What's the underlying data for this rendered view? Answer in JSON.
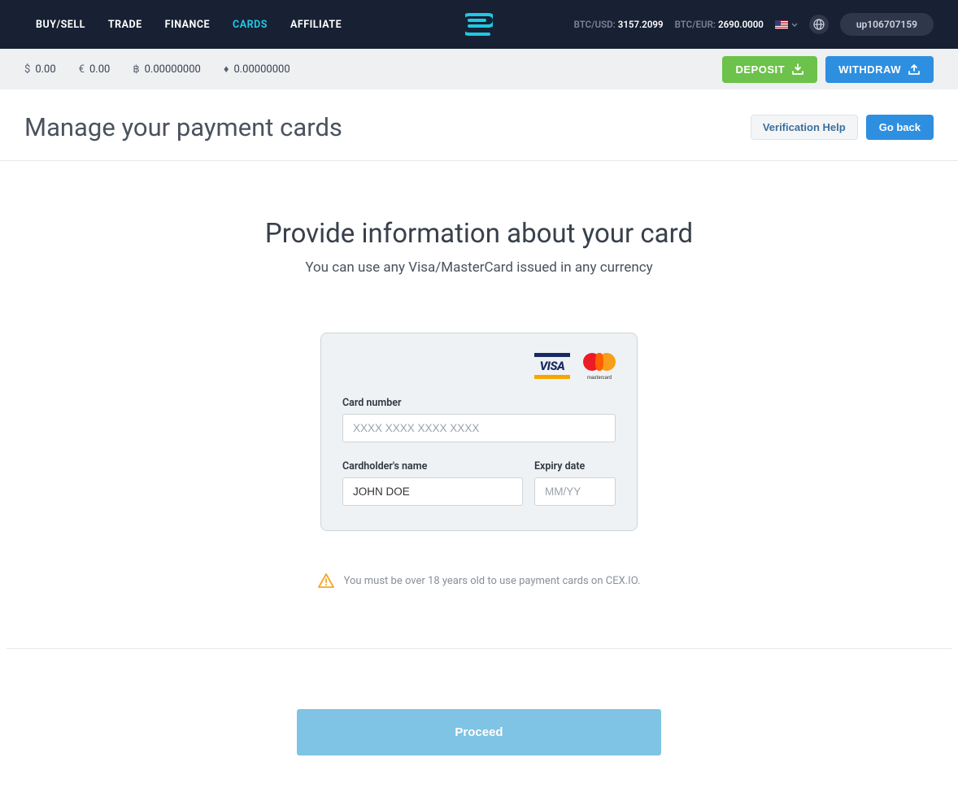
{
  "nav": {
    "items": [
      {
        "label": "BUY/SELL"
      },
      {
        "label": "TRADE"
      },
      {
        "label": "FINANCE"
      },
      {
        "label": "CARDS"
      },
      {
        "label": "AFFILIATE"
      }
    ],
    "tickers": [
      {
        "label": "BTC/USD:",
        "value": "3157.2099"
      },
      {
        "label": "BTC/EUR:",
        "value": "2690.0000"
      }
    ],
    "user": "up106707159"
  },
  "balances": [
    {
      "symbol": "$",
      "value": "0.00"
    },
    {
      "symbol": "€",
      "value": "0.00"
    },
    {
      "symbol": "฿",
      "value": "0.00000000"
    },
    {
      "symbol": "♦",
      "value": "0.00000000"
    }
  ],
  "actions": {
    "deposit": "DEPOSIT",
    "withdraw": "WITHDRAW"
  },
  "page": {
    "title": "Manage your payment cards",
    "verification_help": "Verification Help",
    "go_back": "Go back"
  },
  "main": {
    "title": "Provide information about your card",
    "subtitle": "You can use any Visa/MasterCard issued in any currency"
  },
  "form": {
    "visa_label": "VISA",
    "mc_label": "mastercard",
    "card_number_label": "Card number",
    "card_number_placeholder": "XXXX XXXX XXXX XXXX",
    "card_number_value": "",
    "cardholder_label": "Cardholder's name",
    "cardholder_value": "JOHN DOE",
    "expiry_label": "Expiry date",
    "expiry_placeholder": "MM/YY",
    "expiry_value": ""
  },
  "warning": "You must be over 18 years old to use payment cards on CEX.IO.",
  "proceed": "Proceed"
}
